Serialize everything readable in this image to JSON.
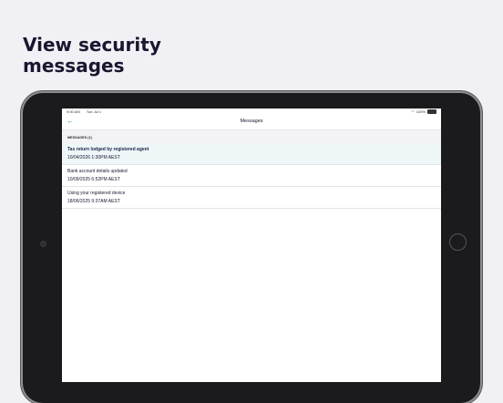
{
  "headline": {
    "line1": "View security",
    "line2": "messages"
  },
  "status_bar": {
    "time": "9:00 AM",
    "date": "Tue Jul 1",
    "battery": "100%"
  },
  "nav": {
    "back_icon": "arrow-left-icon",
    "title": "Messages"
  },
  "section": {
    "header": "MESSAGES (1)"
  },
  "messages": [
    {
      "subject": "Tax return lodged by registered agent",
      "date": "10/04/2026 1:30PM AEST",
      "unread": true
    },
    {
      "subject": "Bank account details updated",
      "date": "10/09/2025 6:52PM AEST",
      "unread": false
    },
    {
      "subject": "Using your registered device",
      "date": "18/06/2025 9:37AM AEST",
      "unread": false
    }
  ],
  "colors": {
    "background": "#f1f0f4",
    "headline": "#1b1530",
    "accent": "#2b8a9a",
    "unread_row": "#eef6f8"
  }
}
